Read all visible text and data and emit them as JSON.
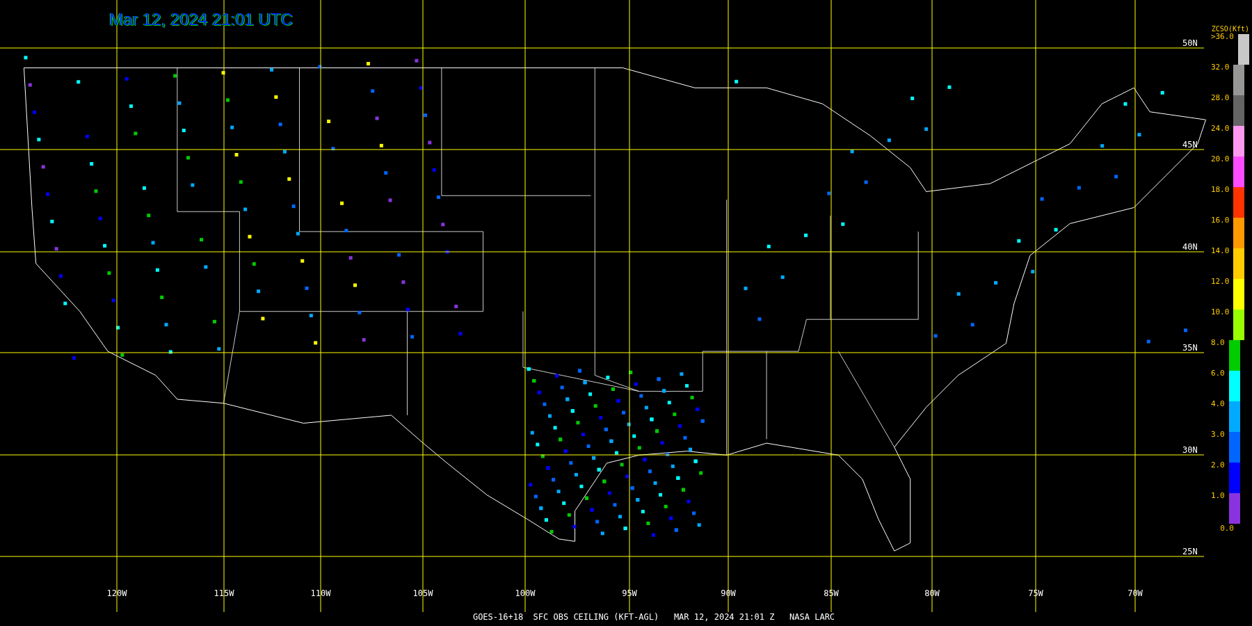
{
  "title": "Mar 12, 2024 21:01 UTC",
  "lat_labels": [
    "50N",
    "45N",
    "40N",
    "35N",
    "30N",
    "25N"
  ],
  "lon_labels": [
    "120W",
    "115W",
    "110W",
    "105W",
    "100W",
    "95W",
    "90W",
    "85W",
    "80W",
    "75W",
    "70W"
  ],
  "legend": {
    "title": "ZCSO(Kft)",
    "bottom_label": "0.0",
    "scale": [
      {
        "label": ">36.0",
        "color": "#c8c8c8"
      },
      {
        "label": "32.0",
        "color": "#969696"
      },
      {
        "label": "28.0",
        "color": "#646464"
      },
      {
        "label": "24.0",
        "color": "#ff99f0"
      },
      {
        "label": "20.0",
        "color": "#ff4cff"
      },
      {
        "label": "18.0",
        "color": "#ff3300"
      },
      {
        "label": "16.0",
        "color": "#ff9900"
      },
      {
        "label": "14.0",
        "color": "#ffcc00"
      },
      {
        "label": "12.0",
        "color": "#ffff00"
      },
      {
        "label": "10.0",
        "color": "#99ff00"
      },
      {
        "label": "8.0",
        "color": "#00cc00"
      },
      {
        "label": "6.0",
        "color": "#00ffff"
      },
      {
        "label": "4.0",
        "color": "#00aaff"
      },
      {
        "label": "3.0",
        "color": "#0066ff"
      },
      {
        "label": "2.0",
        "color": "#0000ff"
      },
      {
        "label": "1.0",
        "color": "#8833dd"
      }
    ]
  },
  "footer": "GOES-16+18  SFC OBS CEILING (KFT-AGL)   MAR 12, 2024 21:01 Z   NASA LARC"
}
